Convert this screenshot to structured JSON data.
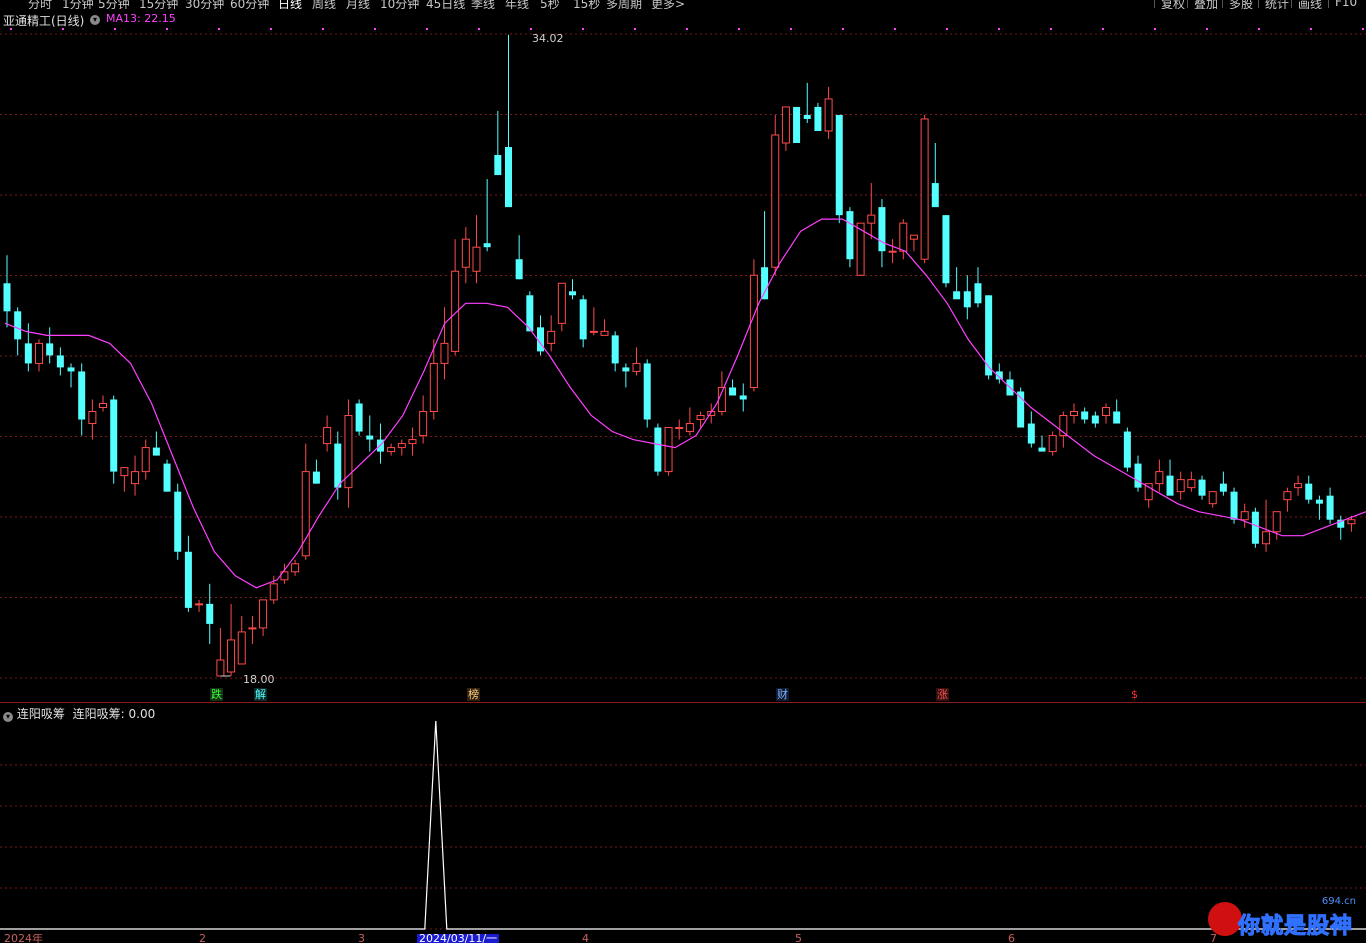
{
  "toolbar": {
    "periods": [
      "分时",
      "1分钟",
      "5分钟",
      "15分钟",
      "30分钟",
      "60分钟",
      "日线",
      "周线",
      "月线",
      "10分钟",
      "45日线",
      "季线",
      "年线",
      "5秒",
      "15秒",
      "多周期",
      "更多>"
    ],
    "active_period": "日线",
    "right_buttons": [
      "复权",
      "叠加",
      "多股",
      "统计",
      "画线",
      "F10"
    ]
  },
  "header": {
    "stock_title": "亚通精工(日线)",
    "ma_label": "MA13: 22.15",
    "dropdown_icon": "chevron-down-icon"
  },
  "main_chart": {
    "high_label": "34.02",
    "low_label": "18.00"
  },
  "events": [
    "跌",
    "解",
    "榜",
    "财",
    "涨",
    "$"
  ],
  "sub_chart": {
    "indicator_title": "连阳吸筹",
    "indicator_line": "连阳吸筹: 0.00"
  },
  "x_axis": {
    "labels": [
      "2024年",
      "2",
      "3",
      "4",
      "5",
      "6",
      "7"
    ],
    "cursor_date": "2024/03/11/一"
  },
  "watermark": {
    "text": "你就是股神",
    "site": "694.cn"
  },
  "colors": {
    "up": "#ff4a4a",
    "down": "#54ffff",
    "ma": "#ff40ff",
    "grid": "#7a1a1a",
    "indicator": "#ffffff"
  },
  "chart_data": {
    "type": "candlestick",
    "title": "亚通精工(日线)",
    "max_price": 34.02,
    "min_price": 18.0,
    "ma13_last": 22.15,
    "candles_ohlc": [
      [
        27.8,
        28.5,
        26.7,
        27.1
      ],
      [
        27.1,
        27.2,
        26.0,
        26.4
      ],
      [
        26.3,
        26.8,
        25.6,
        25.8
      ],
      [
        25.8,
        26.4,
        25.6,
        26.3
      ],
      [
        26.3,
        26.7,
        25.8,
        26.0
      ],
      [
        26.0,
        26.2,
        25.5,
        25.7
      ],
      [
        25.7,
        25.8,
        25.2,
        25.6
      ],
      [
        25.6,
        25.8,
        24.0,
        24.4
      ],
      [
        24.3,
        24.9,
        23.9,
        24.6
      ],
      [
        24.7,
        25.0,
        24.6,
        24.8
      ],
      [
        24.9,
        25.0,
        22.8,
        23.1
      ],
      [
        23.0,
        23.2,
        22.6,
        23.2
      ],
      [
        22.8,
        23.5,
        22.5,
        23.1
      ],
      [
        23.1,
        23.9,
        22.9,
        23.7
      ],
      [
        23.7,
        24.1,
        23.5,
        23.5
      ],
      [
        23.3,
        23.4,
        22.6,
        22.6
      ],
      [
        22.6,
        22.8,
        20.9,
        21.1
      ],
      [
        21.1,
        21.5,
        19.6,
        19.7
      ],
      [
        19.8,
        19.9,
        19.6,
        19.8
      ],
      [
        19.8,
        20.3,
        18.8,
        19.3
      ],
      [
        18.0,
        19.2,
        18.0,
        18.4
      ],
      [
        18.1,
        19.8,
        18.0,
        18.9
      ],
      [
        18.3,
        19.5,
        18.3,
        19.1
      ],
      [
        19.2,
        19.5,
        18.8,
        19.2
      ],
      [
        19.2,
        19.8,
        19.0,
        19.9
      ],
      [
        19.9,
        20.5,
        19.8,
        20.3
      ],
      [
        20.4,
        20.8,
        20.3,
        20.6
      ],
      [
        20.6,
        20.9,
        20.5,
        20.8
      ],
      [
        21.0,
        23.8,
        20.9,
        23.1
      ],
      [
        23.1,
        23.4,
        22.8,
        22.8
      ],
      [
        23.8,
        24.5,
        23.6,
        24.2
      ],
      [
        23.8,
        24.1,
        22.4,
        22.7
      ],
      [
        22.7,
        24.9,
        22.2,
        24.5
      ],
      [
        24.8,
        24.9,
        24.0,
        24.1
      ],
      [
        24.0,
        24.5,
        23.6,
        23.9
      ],
      [
        23.9,
        24.3,
        23.3,
        23.6
      ],
      [
        23.6,
        23.8,
        23.5,
        23.7
      ],
      [
        23.7,
        23.9,
        23.5,
        23.8
      ],
      [
        23.8,
        24.2,
        23.5,
        23.9
      ],
      [
        24.0,
        25.0,
        23.8,
        24.6
      ],
      [
        24.6,
        26.4,
        24.4,
        25.8
      ],
      [
        25.8,
        27.2,
        25.4,
        26.3
      ],
      [
        26.1,
        28.9,
        26.0,
        28.1
      ],
      [
        28.2,
        29.2,
        27.8,
        28.9
      ],
      [
        28.1,
        29.5,
        27.8,
        28.7
      ],
      [
        28.8,
        30.4,
        28.6,
        28.7
      ],
      [
        31.0,
        32.1,
        30.6,
        30.5
      ],
      [
        31.2,
        34.0,
        31.0,
        29.7
      ],
      [
        28.4,
        29.0,
        27.9,
        27.9
      ],
      [
        27.5,
        27.6,
        26.8,
        26.6
      ],
      [
        26.7,
        27.0,
        26.0,
        26.1
      ],
      [
        26.3,
        27.0,
        26.1,
        26.6
      ],
      [
        26.8,
        27.6,
        26.6,
        27.8
      ],
      [
        27.6,
        27.9,
        27.4,
        27.5
      ],
      [
        27.4,
        27.5,
        26.2,
        26.4
      ],
      [
        26.6,
        27.2,
        26.5,
        26.6
      ],
      [
        26.5,
        26.9,
        26.5,
        26.6
      ],
      [
        26.5,
        26.6,
        25.6,
        25.8
      ],
      [
        25.7,
        25.8,
        25.2,
        25.6
      ],
      [
        25.6,
        26.2,
        25.5,
        25.8
      ],
      [
        25.8,
        25.9,
        24.2,
        24.4
      ],
      [
        24.2,
        24.3,
        23.0,
        23.1
      ],
      [
        23.1,
        24.2,
        23.0,
        24.2
      ],
      [
        24.2,
        24.4,
        23.9,
        24.2
      ],
      [
        24.1,
        24.7,
        24.0,
        24.3
      ],
      [
        24.4,
        24.6,
        24.2,
        24.5
      ],
      [
        24.5,
        24.8,
        24.3,
        24.6
      ],
      [
        24.6,
        25.6,
        24.5,
        25.2
      ],
      [
        25.2,
        25.4,
        25.0,
        25.0
      ],
      [
        25.0,
        25.3,
        24.6,
        24.9
      ],
      [
        25.2,
        28.4,
        25.1,
        28.0
      ],
      [
        28.2,
        29.6,
        27.4,
        27.4
      ],
      [
        28.2,
        32.0,
        28.0,
        31.5
      ],
      [
        31.3,
        32.1,
        31.1,
        32.2
      ],
      [
        32.2,
        32.2,
        31.6,
        31.3
      ],
      [
        32.0,
        32.8,
        31.8,
        31.9
      ],
      [
        32.2,
        32.3,
        31.8,
        31.6
      ],
      [
        31.6,
        32.7,
        31.4,
        32.4
      ],
      [
        32.0,
        32.0,
        29.3,
        29.5
      ],
      [
        29.6,
        29.7,
        28.2,
        28.4
      ],
      [
        28.0,
        28.5,
        28.0,
        29.3
      ],
      [
        29.3,
        30.3,
        28.9,
        29.5
      ],
      [
        29.7,
        29.9,
        28.2,
        28.6
      ],
      [
        28.6,
        28.9,
        28.3,
        28.6
      ],
      [
        28.6,
        29.4,
        28.4,
        29.3
      ],
      [
        28.9,
        29.0,
        28.6,
        29.0
      ],
      [
        28.4,
        32.0,
        28.3,
        31.9
      ],
      [
        30.3,
        31.3,
        30.0,
        29.7
      ],
      [
        29.5,
        29.5,
        27.7,
        27.8
      ],
      [
        27.6,
        28.2,
        27.6,
        27.4
      ],
      [
        27.6,
        28.0,
        26.9,
        27.2
      ],
      [
        27.8,
        28.2,
        27.2,
        27.3
      ],
      [
        27.5,
        27.5,
        25.4,
        25.5
      ],
      [
        25.6,
        25.8,
        25.3,
        25.4
      ],
      [
        25.4,
        25.6,
        25.0,
        25.0
      ],
      [
        25.1,
        25.2,
        24.6,
        24.2
      ],
      [
        24.3,
        24.6,
        23.7,
        23.8
      ],
      [
        23.7,
        24.0,
        23.6,
        23.6
      ],
      [
        23.6,
        24.1,
        23.5,
        24.0
      ],
      [
        24.0,
        24.6,
        23.7,
        24.5
      ],
      [
        24.5,
        24.8,
        24.3,
        24.6
      ],
      [
        24.6,
        24.7,
        24.3,
        24.4
      ],
      [
        24.5,
        24.6,
        24.2,
        24.3
      ],
      [
        24.5,
        24.8,
        24.3,
        24.7
      ],
      [
        24.6,
        24.9,
        24.4,
        24.3
      ],
      [
        24.1,
        24.2,
        23.1,
        23.2
      ],
      [
        23.3,
        23.5,
        22.6,
        22.7
      ],
      [
        22.4,
        22.4,
        22.2,
        22.8
      ],
      [
        22.8,
        23.4,
        22.6,
        23.1
      ],
      [
        23.0,
        23.4,
        22.6,
        22.5
      ],
      [
        22.6,
        23.1,
        22.4,
        22.9
      ],
      [
        22.7,
        23.1,
        22.6,
        22.9
      ],
      [
        22.9,
        23.0,
        22.4,
        22.5
      ],
      [
        22.3,
        22.6,
        22.2,
        22.6
      ],
      [
        22.8,
        23.1,
        22.5,
        22.6
      ],
      [
        22.6,
        22.7,
        21.8,
        21.9
      ],
      [
        21.9,
        22.3,
        21.7,
        22.1
      ],
      [
        22.1,
        22.2,
        21.2,
        21.3
      ],
      [
        21.3,
        22.4,
        21.1,
        21.6
      ],
      [
        21.6,
        22.0,
        21.4,
        22.1
      ],
      [
        22.4,
        22.7,
        22.1,
        22.6
      ],
      [
        22.7,
        23.0,
        22.5,
        22.8
      ],
      [
        22.8,
        23.0,
        22.3,
        22.4
      ],
      [
        22.4,
        22.5,
        21.9,
        22.3
      ],
      [
        22.5,
        22.7,
        21.8,
        21.9
      ],
      [
        21.9,
        22.0,
        21.4,
        21.7
      ],
      [
        21.8,
        22.0,
        21.6,
        21.9
      ]
    ],
    "ma13": [
      26.8,
      26.6,
      26.5,
      26.5,
      26.5,
      26.3,
      25.8,
      24.8,
      23.5,
      22.2,
      21.1,
      20.5,
      20.2,
      20.4,
      21.1,
      22.0,
      22.8,
      23.3,
      23.8,
      24.5,
      25.6,
      26.8,
      27.3,
      27.3,
      27.2,
      26.7,
      26.0,
      25.2,
      24.5,
      24.1,
      23.9,
      23.8,
      23.7,
      24.0,
      24.8,
      26.0,
      27.3,
      28.3,
      29.1,
      29.4,
      29.4,
      29.1,
      28.8,
      28.6,
      28.0,
      27.3,
      26.4,
      25.7,
      25.2,
      24.7,
      24.3,
      23.9,
      23.5,
      23.2,
      22.9,
      22.6,
      22.3,
      22.1,
      22.0,
      21.9,
      21.7,
      21.5,
      21.5,
      21.7,
      21.9,
      22.1
    ],
    "sub_indicator": {
      "name": "连阳吸筹",
      "value": 0.0,
      "peaks": [
        {
          "index": 40,
          "value": 1
        }
      ]
    }
  }
}
